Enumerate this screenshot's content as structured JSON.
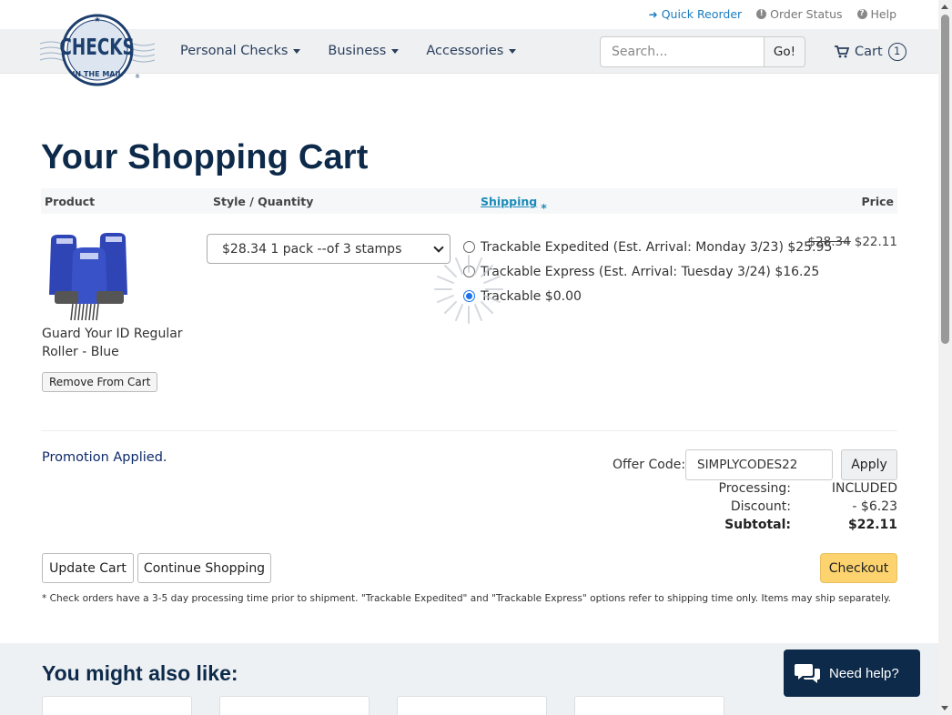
{
  "toplinks": {
    "quick_reorder": "Quick Reorder",
    "order_status": "Order Status",
    "help": "Help"
  },
  "logo": {
    "line1": "CHECKS",
    "line2": "IN THE MAIL"
  },
  "nav": {
    "items": [
      {
        "label": "Personal Checks"
      },
      {
        "label": "Business"
      },
      {
        "label": "Accessories"
      }
    ],
    "search_placeholder": "Search...",
    "search_button": "Go!",
    "cart_label": "Cart",
    "cart_count": "1"
  },
  "page": {
    "title": "Your Shopping Cart"
  },
  "table": {
    "headers": {
      "product": "Product",
      "style_qty": "Style / Quantity",
      "shipping": "Shipping",
      "shipping_star": "*",
      "price": "Price"
    }
  },
  "item": {
    "name": "Guard Your ID Regular Roller - Blue",
    "remove_label": "Remove From Cart",
    "quantity_selected": "$28.34 1 pack --of 3 stamps",
    "shipping_options": [
      {
        "label": "Trackable Expedited (Est. Arrival: Monday 3/23) $25.95",
        "selected": false
      },
      {
        "label": "Trackable Express (Est. Arrival: Tuesday 3/24) $16.25",
        "selected": false
      },
      {
        "label": "Trackable $0.00",
        "selected": true
      }
    ],
    "price_old": "$28.34",
    "price_new": "$22.11"
  },
  "promo": {
    "message": "Promotion Applied.",
    "offer_label": "Offer Code:",
    "offer_value": "SIMPLYCODES22",
    "apply_label": "Apply"
  },
  "totals": {
    "processing_label": "Processing:",
    "processing_value": "INCLUDED",
    "discount_label": "Discount:",
    "discount_value": "- $6.23",
    "subtotal_label": "Subtotal:",
    "subtotal_value": "$22.11"
  },
  "actions": {
    "update": "Update Cart",
    "continue": "Continue Shopping",
    "checkout": "Checkout"
  },
  "footnote": "* Check orders have a 3-5 day processing time prior to shipment. \"Trackable Expedited\" and \"Trackable Express\" options refer to shipping time only. Items may ship separately.",
  "suggestions": {
    "title": "You might also like:"
  },
  "help_widget": {
    "label": "Need help?"
  },
  "colors": {
    "brand_navy": "#0d2a4a",
    "link_blue": "#1a7cc0",
    "checkout_yellow": "#fcd36e",
    "nav_bg": "#eef0f2"
  }
}
